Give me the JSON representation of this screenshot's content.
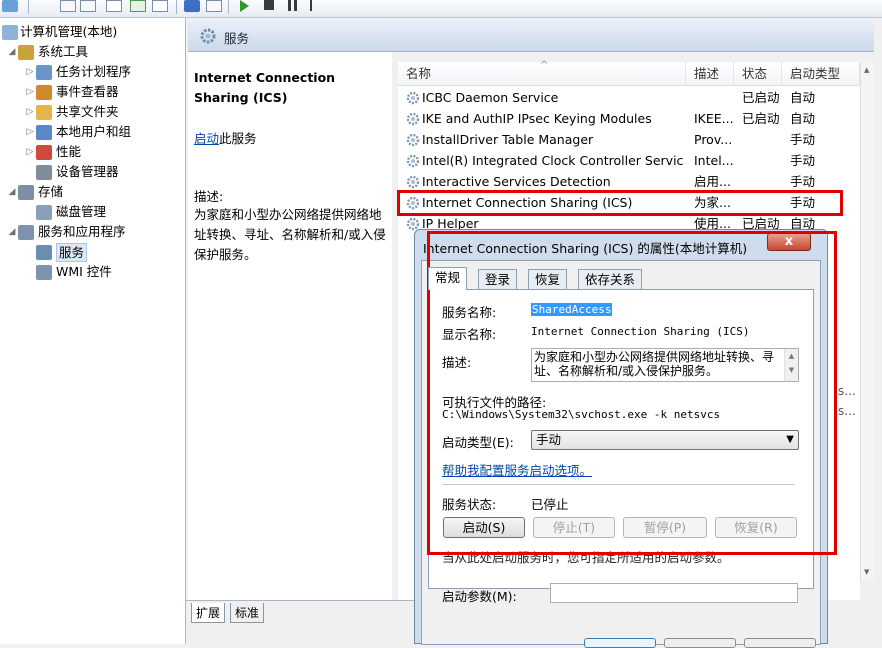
{
  "tree": {
    "root": "计算机管理(本地)",
    "items": [
      {
        "label": "系统工具",
        "expander": "◢",
        "icon": "tools-icon",
        "level": 1
      },
      {
        "label": "任务计划程序",
        "expander": "▷",
        "icon": "clock-icon",
        "level": 2
      },
      {
        "label": "事件查看器",
        "expander": "▷",
        "icon": "event-viewer-icon",
        "level": 2
      },
      {
        "label": "共享文件夹",
        "expander": "▷",
        "icon": "shared-folder-icon",
        "level": 2
      },
      {
        "label": "本地用户和组",
        "expander": "▷",
        "icon": "users-icon",
        "level": 2
      },
      {
        "label": "性能",
        "expander": "▷",
        "icon": "performance-icon",
        "level": 2
      },
      {
        "label": "设备管理器",
        "expander": "",
        "icon": "device-manager-icon",
        "level": 2
      },
      {
        "label": "存储",
        "expander": "◢",
        "icon": "storage-icon",
        "level": 1
      },
      {
        "label": "磁盘管理",
        "expander": "",
        "icon": "disk-icon",
        "level": 2
      },
      {
        "label": "服务和应用程序",
        "expander": "◢",
        "icon": "apps-icon",
        "level": 1
      },
      {
        "label": "服务",
        "expander": "",
        "icon": "gear-icon",
        "level": 2,
        "selected": true
      },
      {
        "label": "WMI 控件",
        "expander": "",
        "icon": "wmi-icon",
        "level": 2
      }
    ],
    "bottom_tabs": [
      "扩展",
      "标准"
    ]
  },
  "services_header": {
    "title": "服务"
  },
  "description_pane": {
    "service_name": "Internet Connection Sharing (ICS)",
    "start_link": "启动",
    "start_suffix": "此服务",
    "desc_label": "描述:",
    "desc_text": "为家庭和小型办公网络提供网络地址转换、寻址、名称解析和/或入侵保护服务。"
  },
  "list": {
    "columns": [
      "名称",
      "描述",
      "状态",
      "启动类型"
    ],
    "sort_indicator": "^",
    "rows": [
      {
        "name": "ICBC Daemon Service",
        "desc": "",
        "status": "已启动",
        "startup": "自动"
      },
      {
        "name": "IKE and AuthIP IPsec Keying Modules",
        "desc": "IKEE...",
        "status": "已启动",
        "startup": "自动"
      },
      {
        "name": "InstallDriver Table Manager",
        "desc": "Prov...",
        "status": "",
        "startup": "手动"
      },
      {
        "name": "Intel(R) Integrated Clock Controller Service ...",
        "desc": "Intel...",
        "status": "",
        "startup": "手动"
      },
      {
        "name": "Interactive Services Detection",
        "desc": "启用...",
        "status": "",
        "startup": "手动"
      },
      {
        "name": "Internet Connection Sharing (ICS)",
        "desc": "为家...",
        "status": "",
        "startup": "手动"
      },
      {
        "name": "IP Helper",
        "desc": "使用...",
        "status": "已启动",
        "startup": "自动"
      }
    ],
    "overflow_fragments": [
      "s...",
      "s..."
    ]
  },
  "dialog": {
    "title": "Internet Connection Sharing (ICS) 的属性(本地计算机)",
    "close_glyph": "x",
    "tabs": [
      "常规",
      "登录",
      "恢复",
      "依存关系"
    ],
    "service_name_label": "服务名称:",
    "service_name_value": "SharedAccess",
    "display_name_label": "显示名称:",
    "display_name_value": "Internet Connection Sharing (ICS)",
    "desc_label": "描述:",
    "desc_value": "为家庭和小型办公网络提供网络地址转换、寻址、名称解析和/或入侵保护服务。",
    "path_label": "可执行文件的路径:",
    "path_value": "C:\\Windows\\System32\\svchost.exe -k netsvcs",
    "startup_type_label": "启动类型(E):",
    "startup_type_value": "手动",
    "help_link": "帮助我配置服务启动选项。",
    "status_label": "服务状态:",
    "status_value": "已停止",
    "buttons": {
      "start": "启动(S)",
      "stop": "停止(T)",
      "pause": "暂停(P)",
      "resume": "恢复(R)"
    },
    "hint_text": "当从此处启动服务时，您可指定所适用的启动参数。",
    "param_label": "启动参数(M):",
    "param_value": ""
  },
  "colors": {
    "highlight_red": "#e00000",
    "link_blue": "#0645ad",
    "selection_blue": "#3399ff"
  }
}
